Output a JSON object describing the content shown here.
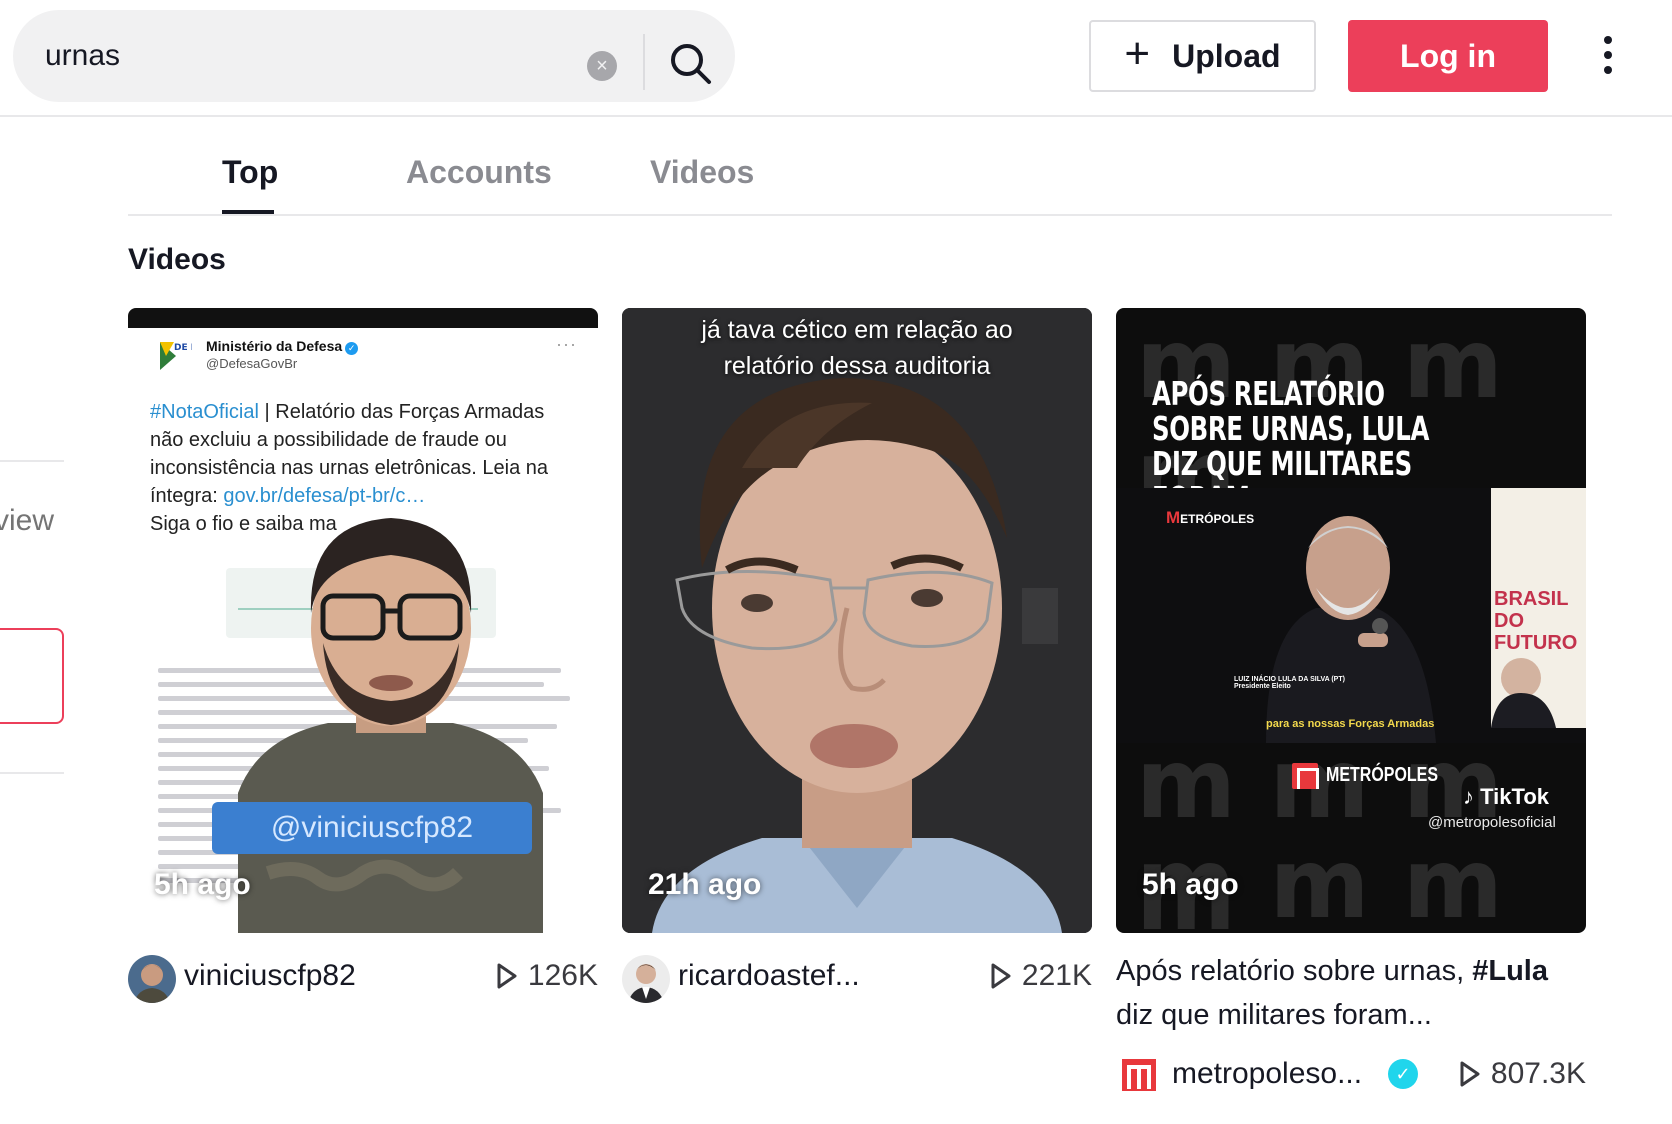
{
  "search": {
    "value": "urnas",
    "clear_icon": "×"
  },
  "header": {
    "upload_label": "Upload",
    "login_label": "Log in"
  },
  "sidebar": {
    "partial_text": "view"
  },
  "tabs": [
    {
      "label": "Top",
      "active": true
    },
    {
      "label": "Accounts",
      "active": false
    },
    {
      "label": "Videos",
      "active": false
    }
  ],
  "section_title": "Videos",
  "colors": {
    "accent": "#ec3f5a",
    "verified": "#20d5ec",
    "tab_inactive": "#8a8b91"
  },
  "videos": [
    {
      "time_ago": "5h ago",
      "username": "viniciuscfp82",
      "plays": "126K",
      "overlay_tag": "@viniciuscfp82",
      "tweet": {
        "author": "Ministério da Defesa",
        "handle": "@DefesaGovBr",
        "logo_text": "DE FE SA",
        "hashtag": "#NotaOficial",
        "body": " | Relatório das Forças Armadas não excluiu a possibilidade de fraude ou inconsistência nas urnas eletrônicas. Leia na íntegra: ",
        "link": "gov.br/defesa/pt-br/c…",
        "tail": "Siga o fio e saiba ma"
      }
    },
    {
      "time_ago": "21h ago",
      "username": "ricardoastef...",
      "plays": "221K",
      "caption_line1": "já tava cético em relação ao",
      "caption_line2": "relatório dessa auditoria"
    },
    {
      "time_ago": "5h ago",
      "headline": "APÓS RELATÓRIO SOBRE URNAS, LULA DIZ QUE MILITARES FORAM “HUMILHADOS”",
      "brand_small_initial": "M",
      "brand_small_rest": "ETRÓPOLES",
      "lower_third_name": "LUIZ INÁCIO LULA DA SILVA (PT)",
      "lower_third_role": "Presidente Eleito",
      "subtitle": "para as nossas Forças Armadas",
      "banner_line1": "BRASIL",
      "banner_line2": "DO FUTURO",
      "brand": "METRÓPOLES",
      "tiktok_label": "TikTok",
      "tiktok_handle": "@metropolesoficial",
      "description_prefix": "Após relatório sobre urnas, ",
      "description_hashtag": "#Lula",
      "description_suffix": " diz que militares foram...",
      "username": "metropoleso...",
      "plays": "807.3K"
    }
  ]
}
